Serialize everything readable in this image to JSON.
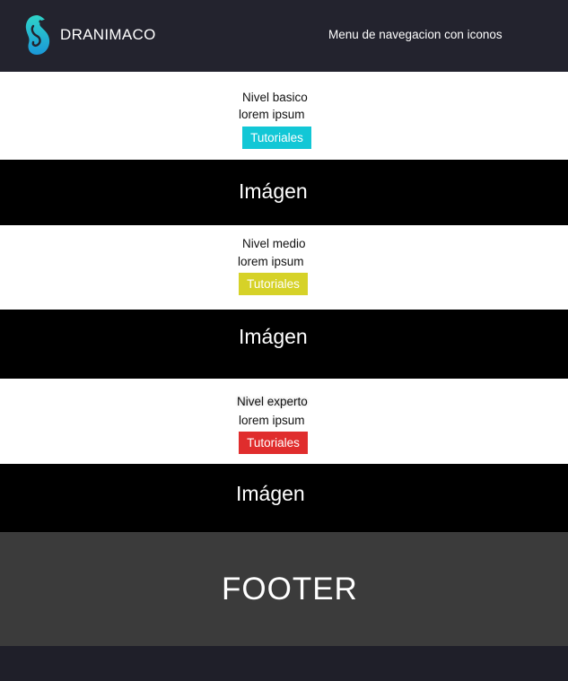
{
  "header": {
    "brand": "DRANIMACO",
    "nav_label": "Menu de navegacion con iconos",
    "logo_icon": "dragon-logo-icon",
    "logo_colors": [
      "#27c2c9",
      "#1aa1d6"
    ]
  },
  "levels": [
    {
      "title": "Nivel basico",
      "description": "lorem ipsum",
      "button_label": "Tutoriales",
      "button_color": "#12c7d6"
    },
    {
      "title": "Nivel medio",
      "description": "lorem ipsum",
      "button_label": "Tutoriales",
      "button_color": "#d6d228"
    },
    {
      "title": "Nivel experto",
      "description": "lorem ipsum",
      "button_label": "Tutoriales",
      "button_color": "#e02d2d"
    }
  ],
  "images": [
    {
      "label": "Imágen"
    },
    {
      "label": "Imágen"
    },
    {
      "label": "Imágen"
    }
  ],
  "footer": {
    "label": "FOOTER"
  }
}
